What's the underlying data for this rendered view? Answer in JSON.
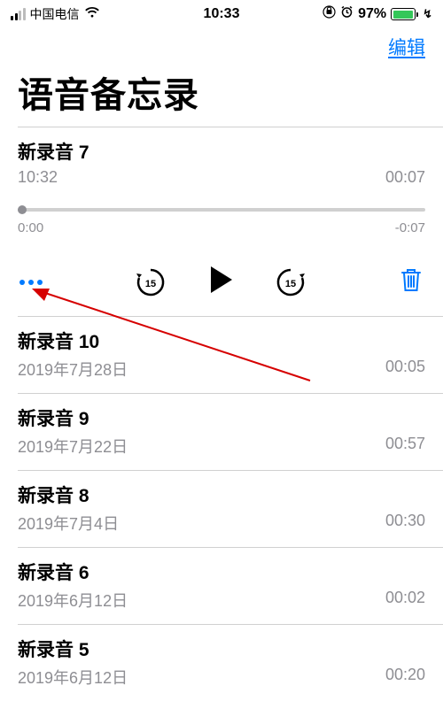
{
  "status": {
    "carrier": "中国电信",
    "time": "10:33",
    "battery_pct": "97%"
  },
  "header": {
    "edit_label": "编辑",
    "title": "语音备忘录"
  },
  "expanded": {
    "title": "新录音 7",
    "time": "10:32",
    "duration": "00:07",
    "scrub_start": "0:00",
    "scrub_end": "-0:07",
    "skip_seconds": "15"
  },
  "recordings": [
    {
      "title": "新录音 10",
      "date": "2019年7月28日",
      "duration": "00:05"
    },
    {
      "title": "新录音 9",
      "date": "2019年7月22日",
      "duration": "00:57"
    },
    {
      "title": "新录音 8",
      "date": "2019年7月4日",
      "duration": "00:30"
    },
    {
      "title": "新录音 6",
      "date": "2019年6月12日",
      "duration": "00:02"
    },
    {
      "title": "新录音 5",
      "date": "2019年6月12日",
      "duration": "00:20"
    }
  ]
}
